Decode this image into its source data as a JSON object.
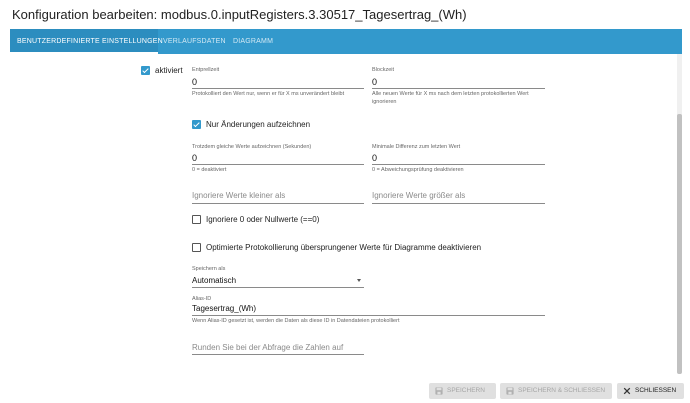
{
  "dialog": {
    "title": "Konfiguration bearbeiten: modbus.0.inputRegisters.3.30517_Tagesertrag_(Wh)"
  },
  "tabs": [
    {
      "label": "BENUTZERDEFINIERTE EINSTELLUNGEN",
      "active": true
    },
    {
      "label": "VERLAUFSDATEN",
      "active": false
    },
    {
      "label": "DIAGRAMM",
      "active": false
    }
  ],
  "settings": {
    "enabled": {
      "label": "aktiviert",
      "checked": true
    },
    "debounce": {
      "label": "Entprellzeit",
      "value": "0",
      "helper": "Protokolliert den Wert nur, wenn er für X ms unverändert bleibt"
    },
    "blocktime": {
      "label": "Blockzeit",
      "value": "0",
      "helper": "Alle neuen Werte für X ms nach dem letzten protokollierten Wert ignorieren"
    },
    "changes_only": {
      "label": "Nur Änderungen aufzeichnen",
      "checked": true
    },
    "same_values": {
      "label": "Trotzdem gleiche Werte aufzeichnen (Sekunden)",
      "value": "0",
      "helper": "0 = deaktiviert"
    },
    "min_diff": {
      "label": "Minimale Differenz zum letzten Wert",
      "value": "0",
      "helper": "0 = Abweichungsprüfung deaktivieren"
    },
    "ignore_below": {
      "placeholder": "Ignoriere Werte kleiner als"
    },
    "ignore_above": {
      "placeholder": "Ignoriere Werte größer als"
    },
    "ignore_zero": {
      "label": "Ignoriere 0 oder Nullwerte (==0)",
      "checked": false
    },
    "disable_skipped": {
      "label": "Optimierte Protokollierung übersprungener Werte für Diagramme deaktivieren",
      "checked": false
    },
    "store_as": {
      "label": "Speichern als",
      "value": "Automatisch"
    },
    "alias": {
      "label": "Alias-ID",
      "value": "Tagesertrag_(Wh)",
      "helper": "Wenn Alias-ID gesetzt ist, werden die Daten als diese ID in Datendateien protokolliert"
    },
    "round": {
      "placeholder": "Runden Sie bei der Abfrage die Zahlen auf"
    }
  },
  "footer": {
    "save": "SPEICHERN",
    "save_close": "SPEICHERN & SCHLIESSEN",
    "close": "SCHLIESSEN"
  },
  "colors": {
    "accent": "#3399cc"
  }
}
